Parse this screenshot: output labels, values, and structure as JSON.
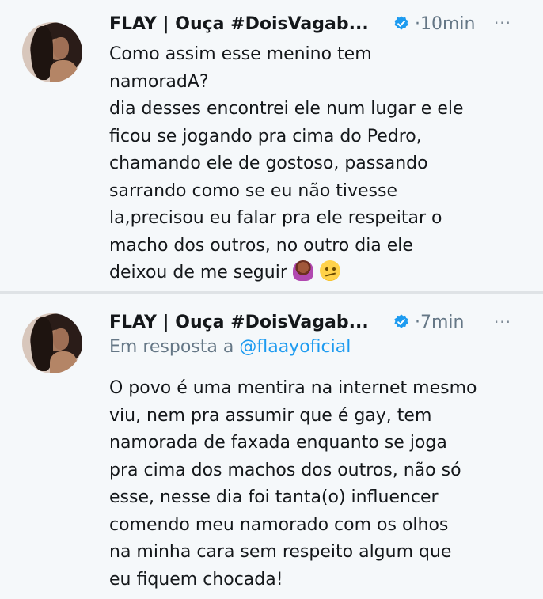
{
  "tweets": [
    {
      "author_name": "FLAY | Ouça #DoisVagab...",
      "time": "·10min",
      "more_label": "···",
      "text": "Como assim esse menino tem\nnamoradA?\ndia desses encontrei ele num lugar e ele\nficou se jogando pra cima do Pedro,\nchamando ele de gostoso, passando\nsarrando como se eu não tivesse\nla,precisou eu falar pra ele respeitar o\nmacho dos outros, no outro dia ele\ndeixou de me seguir",
      "emojis": [
        "woman-tipping-hand-emoji",
        "face-with-raised-eyebrow-emoji"
      ]
    },
    {
      "author_name": "FLAY | Ouça #DoisVagab...",
      "time": "·7min",
      "more_label": "···",
      "reply_prefix": "Em resposta a",
      "reply_handle": "@flaayoficial",
      "text": "O povo é uma mentira na internet mesmo\nviu, nem pra assumir que é gay, tem\nnamorada de faxada enquanto se joga\npra cima dos machos dos outros, não só\nesse, nesse dia foi tanta(o) influencer\ncomendo meu namorado com os olhos\nna minha cara sem respeito algum que\neu fiquem chocada!"
    }
  ],
  "colors": {
    "background": "#f5f8fa",
    "text": "#14171a",
    "secondary": "#657786",
    "accent": "#1d9bf0",
    "divider": "#dfe3e6"
  },
  "icons": [
    "avatar",
    "verified-badge-icon",
    "more-options-icon"
  ]
}
